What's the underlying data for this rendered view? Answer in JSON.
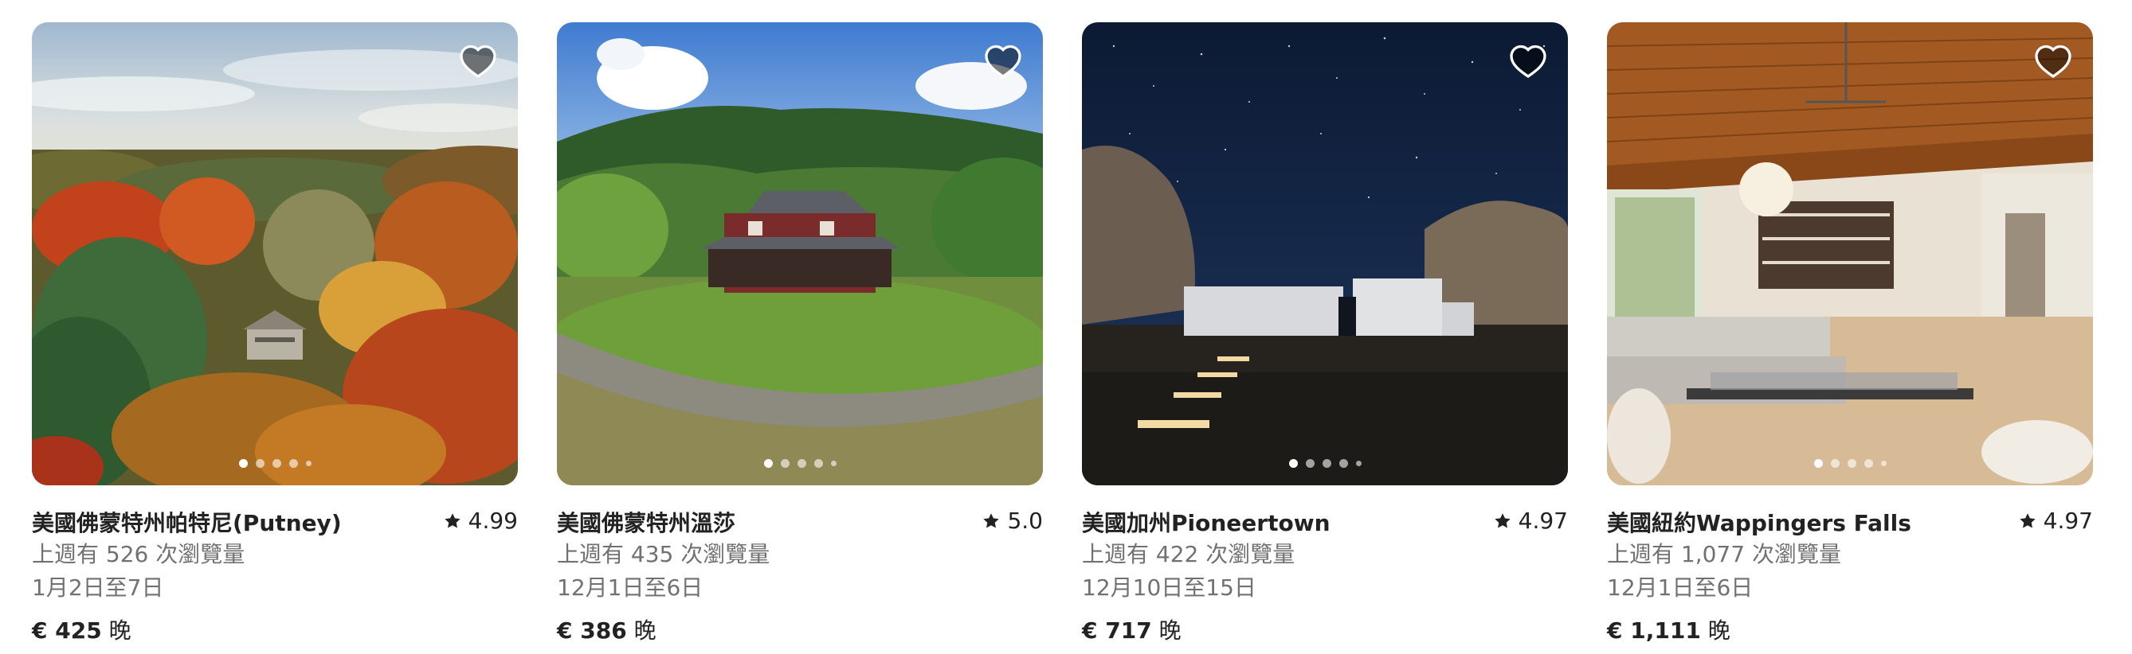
{
  "icons": {
    "favorite": "heart-outline-icon",
    "rating": "star-icon"
  },
  "colors": {
    "text_primary": "#222222",
    "text_secondary": "#717171",
    "heart_fill": "rgba(0,0,0,0.5)",
    "heart_stroke": "#ffffff"
  },
  "listings": [
    {
      "title": "美國佛蒙特州帕特尼(Putney)",
      "rating": "4.99",
      "views": "上週有 526 次瀏覽量",
      "dates": "1月2日至7日",
      "price": "€ 425",
      "price_unit": "晚",
      "photo_count": 5,
      "active_photo": 1
    },
    {
      "title": "美國佛蒙特州溫莎",
      "rating": "5.0",
      "views": "上週有 435 次瀏覽量",
      "dates": "12月1日至6日",
      "price": "€ 386",
      "price_unit": "晚",
      "photo_count": 5,
      "active_photo": 1
    },
    {
      "title": "美國加州Pioneertown",
      "rating": "4.97",
      "views": "上週有 422 次瀏覽量",
      "dates": "12月10日至15日",
      "price": "€ 717",
      "price_unit": "晚",
      "photo_count": 5,
      "active_photo": 1
    },
    {
      "title": "美國紐約Wappingers Falls",
      "rating": "4.97",
      "views": "上週有 1,077 次瀏覽量",
      "dates": "12月1日至6日",
      "price": "€ 1,111",
      "price_unit": "晚",
      "photo_count": 5,
      "active_photo": 1
    }
  ]
}
